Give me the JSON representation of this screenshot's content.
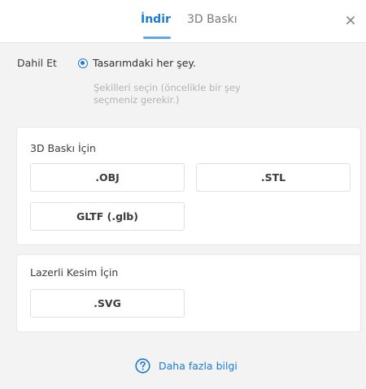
{
  "header": {
    "tabs": [
      {
        "label": "İndir",
        "active": true
      },
      {
        "label": "3D Baskı",
        "active": false
      }
    ],
    "close_icon": "close-icon"
  },
  "include": {
    "label": "Dahil Et",
    "option_label": "Tasarımdaki her şey.",
    "option_selected": true,
    "hint": "Şekilleri seçin (öncelikle bir şey seçmeniz gerekir.)"
  },
  "print_section": {
    "title": "3D Baskı İçin",
    "buttons": [
      ".OBJ",
      ".STL",
      "GLTF (.glb)"
    ]
  },
  "laser_section": {
    "title": "Lazerli Kesim İçin",
    "buttons": [
      ".SVG"
    ]
  },
  "footer": {
    "help_icon": "question-circle-icon",
    "link_text": "Daha fazla bilgi"
  },
  "colors": {
    "accent": "#1b7bd3",
    "tab_underline": "#5aa8ee",
    "panel_bg": "#f3f3f3",
    "hint_text": "#b3b3b3"
  }
}
